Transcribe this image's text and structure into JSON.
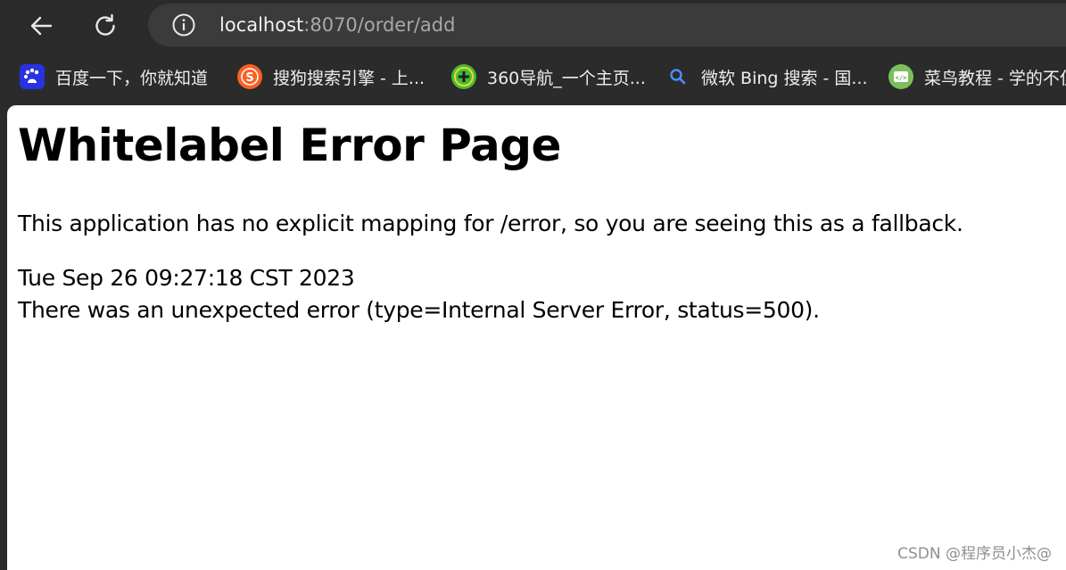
{
  "browser": {
    "address_bar": {
      "host": "localhost",
      "path": ":8070/order/add"
    },
    "bookmarks": [
      {
        "label": "百度一下，你就知道",
        "icon": "baidu-icon",
        "color": "#2932e1"
      },
      {
        "label": "搜狗搜索引擎 - 上...",
        "icon": "sogou-icon",
        "color": "#fb6022"
      },
      {
        "label": "360导航_一个主页...",
        "icon": "360-icon",
        "color": "#3dbd3a"
      },
      {
        "label": "微软 Bing 搜索 - 国...",
        "icon": "search-icon",
        "color": "#4c8dff"
      },
      {
        "label": "菜鸟教程 - 学的不仅",
        "icon": "runoob-icon",
        "color": "#7bbf5b"
      }
    ]
  },
  "page": {
    "title": "Whitelabel Error Page",
    "message": "This application has no explicit mapping for /error, so you are seeing this as a fallback.",
    "timestamp": "Tue Sep 26 09:27:18 CST 2023",
    "error": "There was an unexpected error (type=Internal Server Error, status=500).",
    "watermark": "CSDN @程序员小杰@"
  }
}
